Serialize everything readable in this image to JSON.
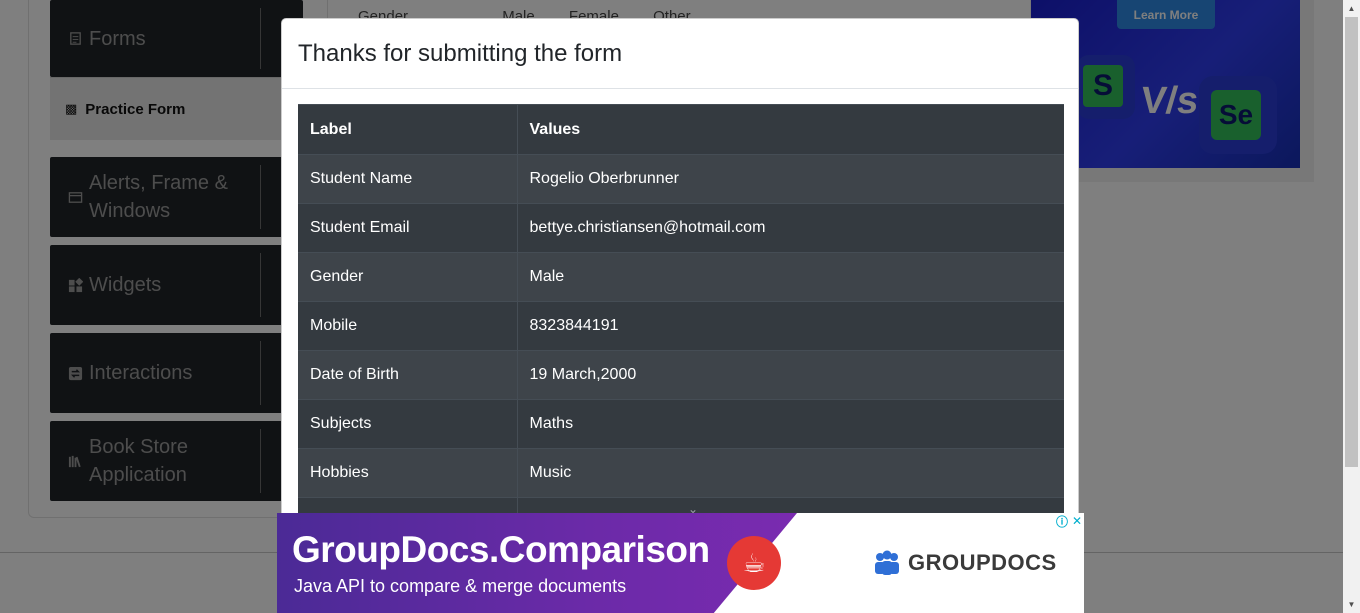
{
  "sidebar": {
    "groups": [
      {
        "label": "Forms",
        "icon": "document-icon"
      },
      {
        "label": "Alerts, Frame & Windows",
        "icon": "window-icon"
      },
      {
        "label": "Widgets",
        "icon": "widgets-icon"
      },
      {
        "label": "Interactions",
        "icon": "interactions-icon"
      },
      {
        "label": "Book Store Application",
        "icon": "books-icon"
      }
    ],
    "active_item": "Practice Form"
  },
  "form_peek": {
    "gender_label": "Gender",
    "options": [
      "Male",
      "Female",
      "Other"
    ]
  },
  "ad_top": {
    "button": "Learn More",
    "logo_s": "S",
    "vs": "V/s",
    "logo_se": "Se"
  },
  "modal": {
    "title": "Thanks for submitting the form",
    "columns": [
      "Label",
      "Values"
    ],
    "rows": [
      {
        "label": "Student Name",
        "value": "Rogelio Oberbrunner"
      },
      {
        "label": "Student Email",
        "value": "bettye.christiansen@hotmail.com"
      },
      {
        "label": "Gender",
        "value": "Male"
      },
      {
        "label": "Mobile",
        "value": "8323844191"
      },
      {
        "label": "Date of Birth",
        "value": "19 March,2000"
      },
      {
        "label": "Subjects",
        "value": "Maths"
      },
      {
        "label": "Hobbies",
        "value": "Music"
      }
    ]
  },
  "ad_bottom": {
    "headline": "GroupDocs.Comparison",
    "subline": "Java API to compare & merge documents",
    "brand": "GROUPDOCS",
    "accent_color": "#5b2aa0"
  },
  "colors": {
    "table_dark": "#343a40",
    "table_alt": "#3e444a",
    "sidebar_group": "#212529",
    "overlay": "rgba(0,0,0,0.5)"
  }
}
